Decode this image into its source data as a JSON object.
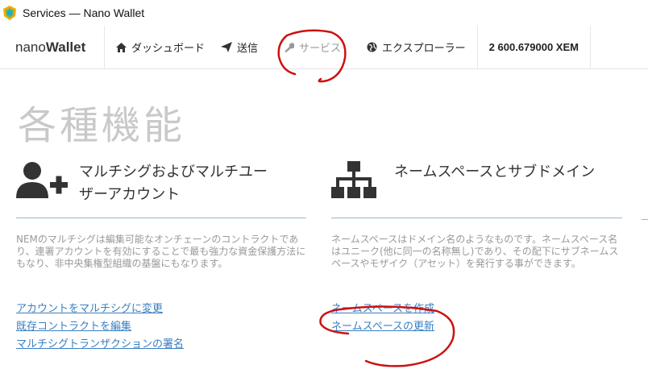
{
  "window": {
    "title": "Services — Nano Wallet"
  },
  "brand": {
    "light": "nano",
    "bold": "Wallet"
  },
  "nav": {
    "dashboard": "ダッシュボード",
    "send": "送信",
    "services": "サービス",
    "explorer": "エクスプローラー",
    "balance": "2 600.679000 XEM"
  },
  "page": {
    "title": "各種機能"
  },
  "cards": {
    "multisig": {
      "title_line1": "マルチシグおよびマルチユー",
      "title_line2": "ザーアカウント",
      "desc": "NEMのマルチシグは編集可能なオンチェーンのコントラクトであり、連署アカウントを有効にすることで最も強力な資金保護方法にもなり、非中央集権型組織の基盤にもなります。",
      "links": [
        "アカウントをマルチシグに変更",
        "既存コントラクトを編集",
        "マルチシグトランザクションの署名"
      ]
    },
    "namespace": {
      "title": "ネームスペースとサブドメイン",
      "desc": "ネームスペースはドメイン名のようなものです。ネームスペース名はユニーク(他に同一の名称無し)であり、その配下にサブネームスペースやモザイク（アセット）を発行する事ができます。",
      "links": [
        "ネームスペースを作成",
        "ネームスペースの更新"
      ]
    }
  },
  "colors": {
    "accent": "#3a7fc1",
    "annotation": "#cc1111",
    "divider": "#9bb8c8",
    "title_gray": "#c9c9c9"
  },
  "icons": [
    "nem-logo-icon",
    "home-icon",
    "send-icon",
    "wrench-icon",
    "globe-icon",
    "user-plus-icon",
    "sitemap-icon"
  ]
}
